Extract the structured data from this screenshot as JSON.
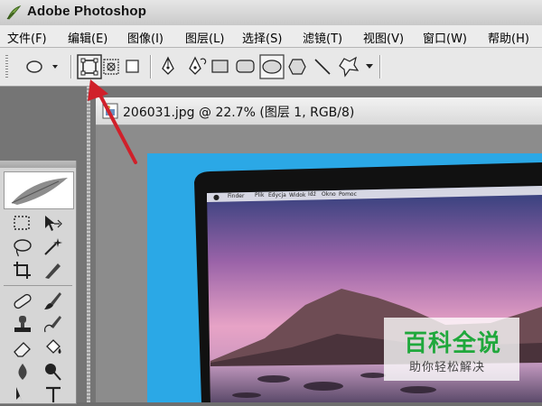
{
  "window": {
    "title": "Adobe Photoshop"
  },
  "menu": [
    "文件(F)",
    "编辑(E)",
    "图像(I)",
    "图层(L)",
    "选择(S)",
    "滤镜(T)",
    "视图(V)",
    "窗口(W)",
    "帮助(H)"
  ],
  "document": {
    "title": "206031.jpg @ 22.7% (图层 1, RGB/8)"
  },
  "mac_menubar": [
    "Finder",
    "Plik",
    "Edycja",
    "Widok",
    "Idź",
    "Okno",
    "Pomoc"
  ],
  "watermark": {
    "main": "百科全说",
    "sub": "助你轻松解决"
  },
  "colors": {
    "canvas_bg": "#2ba8e6",
    "arrow": "#d0202a",
    "watermark_green": "#20a83c"
  },
  "annotation": {
    "arrow": "red arrow pointing to shape-layers mode button"
  }
}
